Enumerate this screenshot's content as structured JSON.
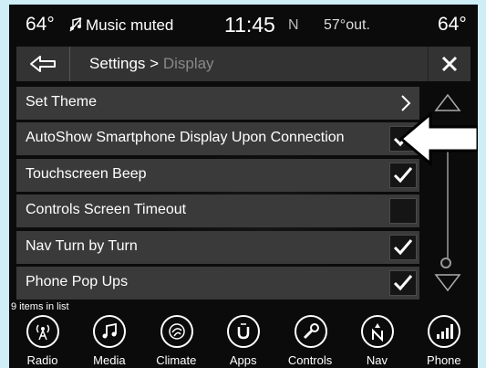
{
  "status": {
    "interior_temp": "64°",
    "audio_status": "Music muted",
    "time": "11:45",
    "compass": "N",
    "outside_temp": "57°out.",
    "right_temp": "64°"
  },
  "header": {
    "breadcrumb_parent": "Settings > ",
    "breadcrumb_current": "Display"
  },
  "list": {
    "items": [
      {
        "label": "Set Theme",
        "control": "chevron"
      },
      {
        "label": "AutoShow Smartphone Display Upon Connection",
        "control": "checkbox",
        "checked": true
      },
      {
        "label": "Touchscreen Beep",
        "control": "checkbox",
        "checked": true
      },
      {
        "label": "Controls Screen Timeout",
        "control": "checkbox",
        "checked": false
      },
      {
        "label": "Nav Turn by Turn",
        "control": "checkbox",
        "checked": true
      },
      {
        "label": "Phone Pop Ups",
        "control": "checkbox",
        "checked": true
      }
    ],
    "count_text": "9 items in list"
  },
  "nav": {
    "items": [
      {
        "label": "Radio",
        "icon": "radio-icon"
      },
      {
        "label": "Media",
        "icon": "media-icon"
      },
      {
        "label": "Climate",
        "icon": "climate-icon"
      },
      {
        "label": "Apps",
        "icon": "apps-icon"
      },
      {
        "label": "Controls",
        "icon": "controls-icon"
      },
      {
        "label": "Nav",
        "icon": "nav-icon"
      },
      {
        "label": "Phone",
        "icon": "phone-icon"
      }
    ]
  }
}
